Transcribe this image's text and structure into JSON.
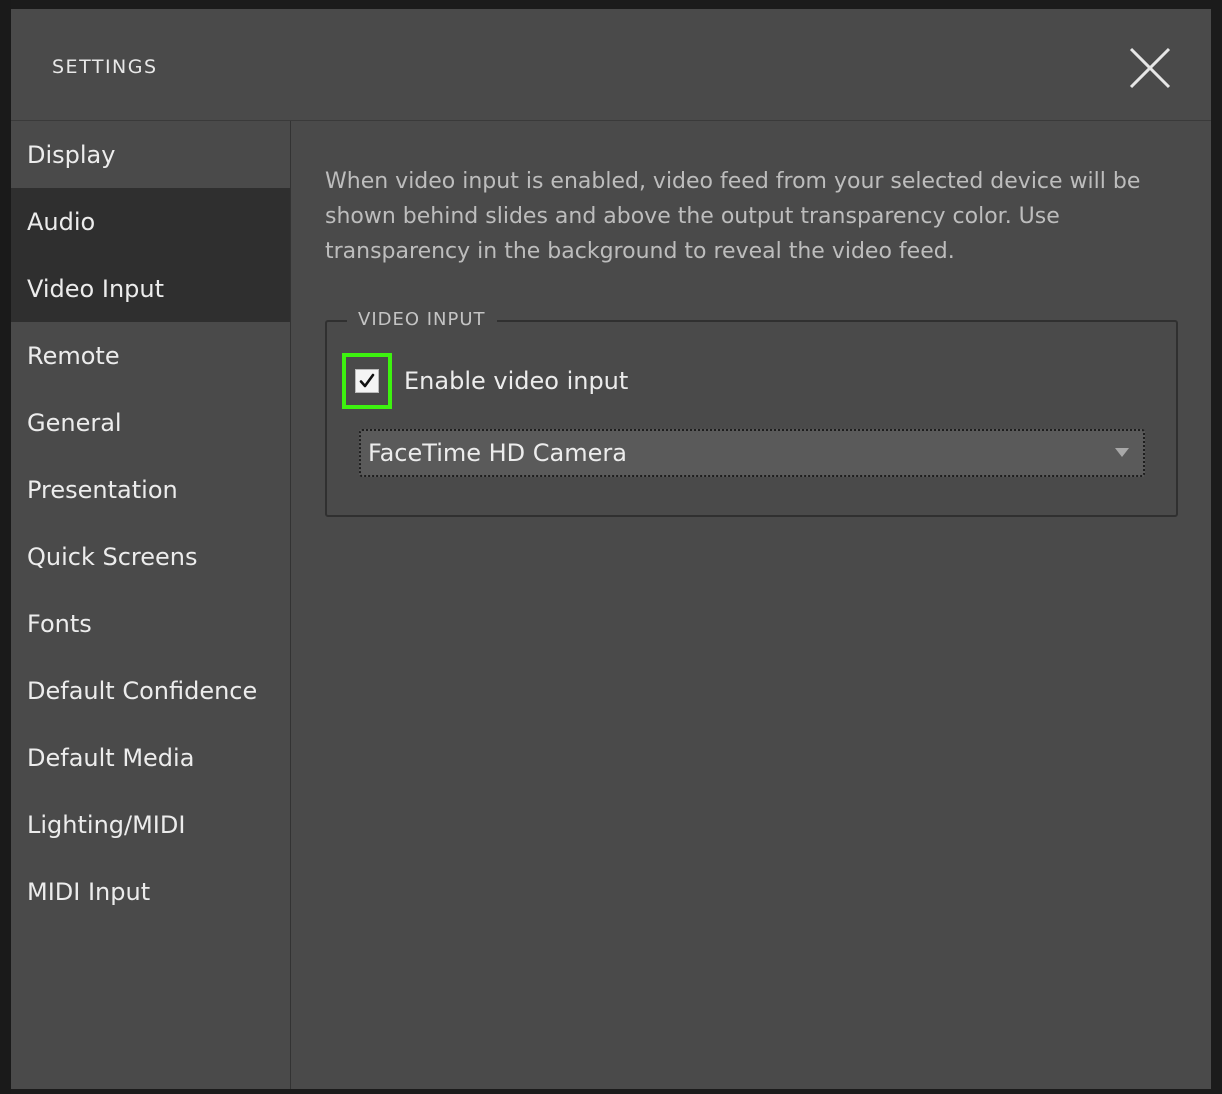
{
  "window": {
    "title": "SETTINGS"
  },
  "sidebar": {
    "items": [
      {
        "label": "Display",
        "active": false
      },
      {
        "label": "Audio",
        "active": true
      },
      {
        "label": "Video Input",
        "active": true
      },
      {
        "label": "Remote",
        "active": false
      },
      {
        "label": "General",
        "active": false
      },
      {
        "label": "Presentation",
        "active": false
      },
      {
        "label": "Quick Screens",
        "active": false
      },
      {
        "label": "Fonts",
        "active": false
      },
      {
        "label": "Default Confidence",
        "active": false
      },
      {
        "label": "Default Media",
        "active": false
      },
      {
        "label": "Lighting/MIDI",
        "active": false
      },
      {
        "label": "MIDI Input",
        "active": false
      }
    ]
  },
  "content": {
    "description": "When video input is enabled, video feed from your selected device will be shown behind slides and above the output transparency color. Use transparency in the background to reveal the video feed.",
    "section_legend": "VIDEO INPUT",
    "enable_checkbox": {
      "label": "Enable video input",
      "checked": true
    },
    "device_select": {
      "value": "FaceTime HD Camera"
    }
  },
  "colors": {
    "panel_bg": "#4a4a4a",
    "active_item_bg": "#2f2f2f",
    "focus_ring": "#3df20f",
    "text_primary": "#ececec",
    "text_secondary": "#bdbdbd"
  },
  "icons": {
    "close": "close-x-icon",
    "check": "checkmark-icon",
    "dropdown": "caret-down-icon"
  }
}
